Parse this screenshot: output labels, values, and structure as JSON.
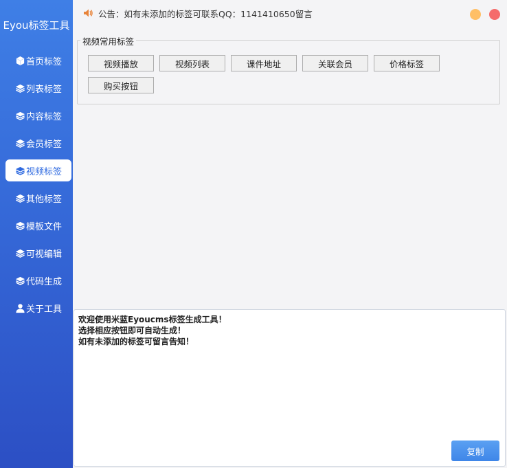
{
  "app_title": "Eyou标签工具",
  "sidebar": {
    "items": [
      {
        "label": "首页标签",
        "icon": "cube-icon"
      },
      {
        "label": "列表标签",
        "icon": "layers-icon"
      },
      {
        "label": "内容标签",
        "icon": "layers-icon"
      },
      {
        "label": "会员标签",
        "icon": "layers-icon"
      },
      {
        "label": "视频标签",
        "icon": "layers-icon",
        "active": true
      },
      {
        "label": "其他标签",
        "icon": "layers-icon"
      },
      {
        "label": "模板文件",
        "icon": "layers-icon"
      },
      {
        "label": "可视编辑",
        "icon": "layers-icon"
      },
      {
        "label": "代码生成",
        "icon": "layers-icon"
      },
      {
        "label": "关于工具",
        "icon": "user-icon"
      }
    ]
  },
  "notice": {
    "text": "公告：如有未添加的标签可联系QQ：1141410650留言",
    "icon": "speaker-icon"
  },
  "window_controls": {
    "minimize_color": "#ffbf66",
    "close_color": "#f56b6b"
  },
  "group": {
    "label": "视频常用标签",
    "buttons": [
      "视频播放",
      "视频列表",
      "课件地址",
      "关联会员",
      "价格标签",
      "购买按钮"
    ]
  },
  "output": {
    "lines": [
      "欢迎使用米蓝Eyoucms标签生成工具！",
      "选择相应按钮即可自动生成！",
      "如有未添加的标签可留言告知！"
    ]
  },
  "copy_label": "复制",
  "colors": {
    "accent": "#3569d8",
    "active_text": "#2f6ae0"
  }
}
